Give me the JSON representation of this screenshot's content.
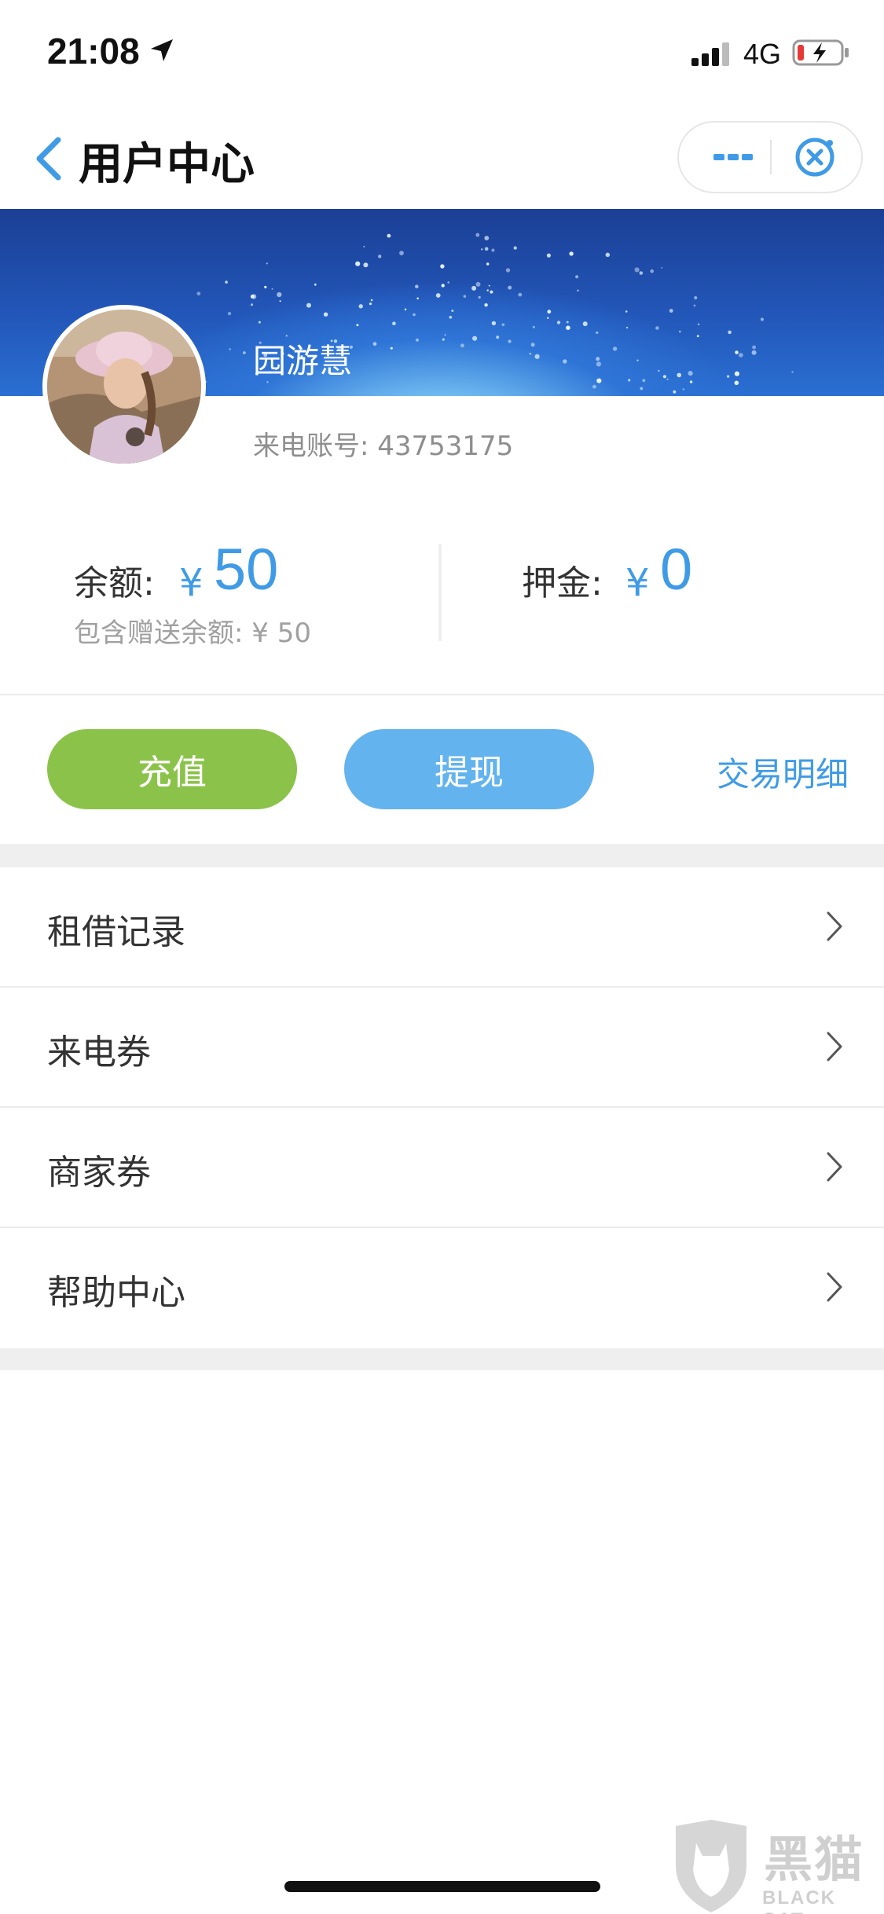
{
  "status_bar": {
    "time": "21:08",
    "network": "4G"
  },
  "nav": {
    "title": "用户中心"
  },
  "user": {
    "name": "园游慧",
    "account_label": "来电账号: 43753175"
  },
  "balance": {
    "label": "余额:",
    "currency": "¥",
    "value": "50",
    "gift_note": "包含赠送余额: ¥ 50",
    "deposit_label": "押金:",
    "deposit_currency": "¥",
    "deposit_value": "0"
  },
  "actions": {
    "recharge": "充值",
    "withdraw": "提现",
    "transactions": "交易明细"
  },
  "menu": [
    {
      "label": "租借记录"
    },
    {
      "label": "来电券"
    },
    {
      "label": "商家券"
    },
    {
      "label": "帮助中心"
    }
  ],
  "watermark": {
    "text": "黑猫",
    "sub": "BLACK CAT"
  },
  "colors": {
    "accent": "#3f9be6",
    "recharge": "#8bc34a",
    "withdraw": "#63b3ee",
    "banner": "#2256b8"
  }
}
